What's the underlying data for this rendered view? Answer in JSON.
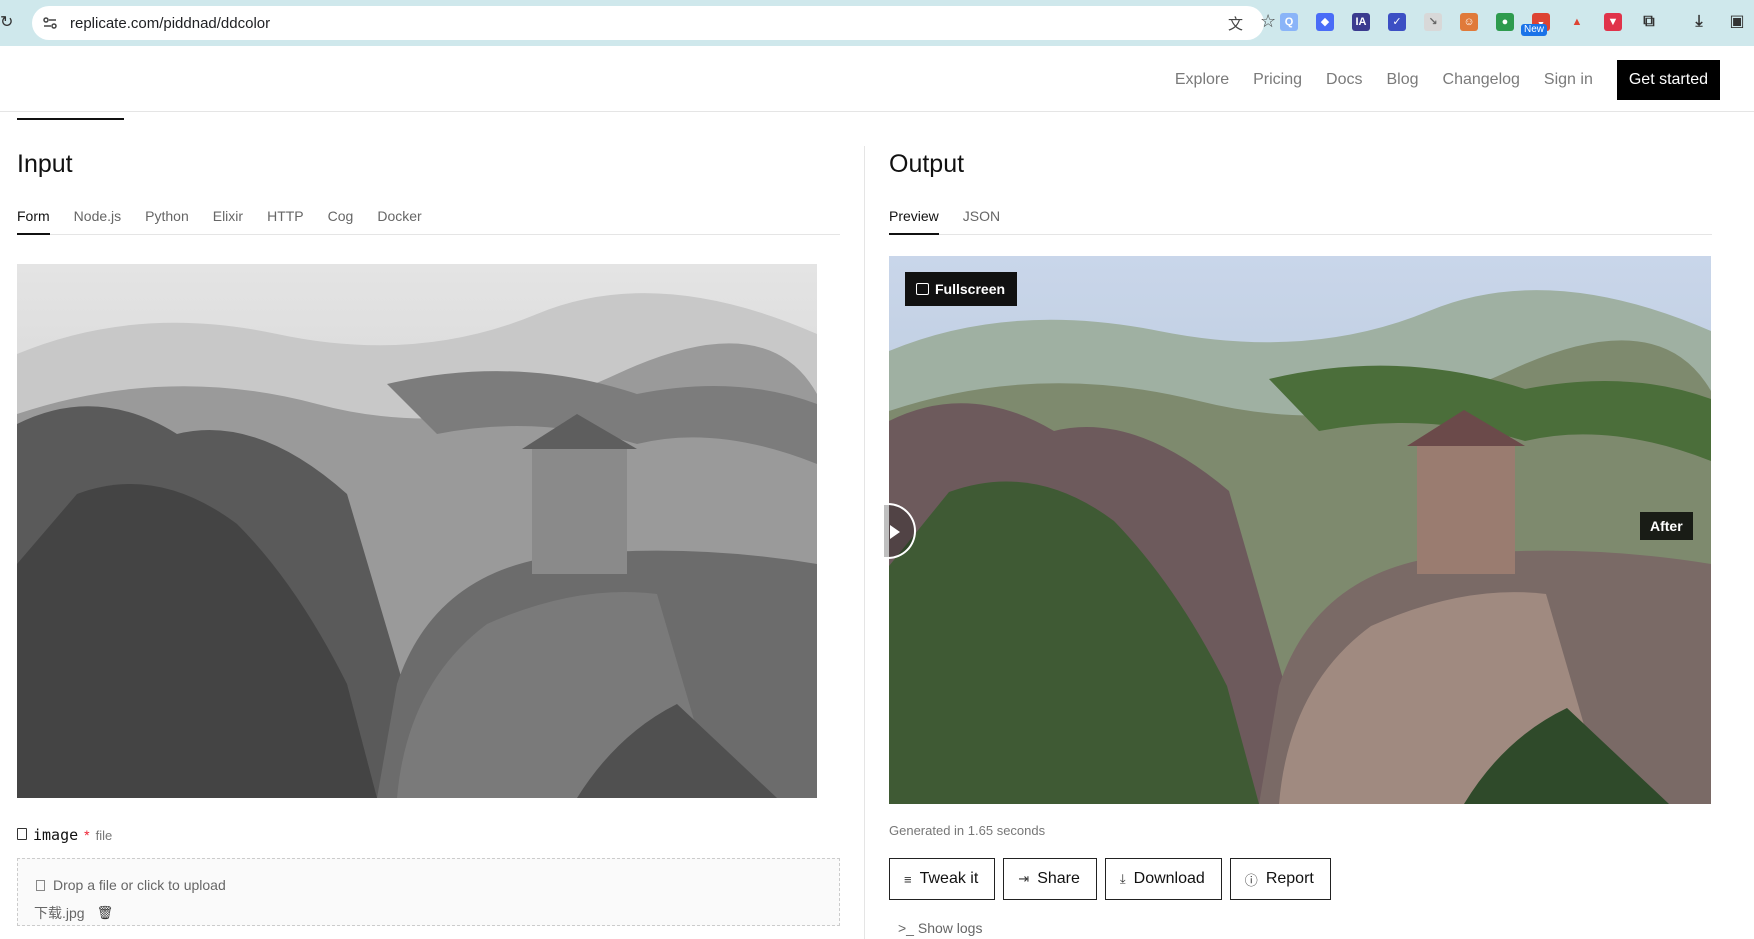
{
  "browser": {
    "url": "replicate.com/piddnad/ddcolor",
    "new_badge": "New",
    "extension_badge_count": "1"
  },
  "nav": {
    "items": [
      "Explore",
      "Pricing",
      "Docs",
      "Blog",
      "Changelog",
      "Sign in"
    ],
    "cta": "Get started"
  },
  "input": {
    "title": "Input",
    "tabs": [
      "Form",
      "Node.js",
      "Python",
      "Elixir",
      "HTTP",
      "Cog",
      "Docker"
    ],
    "field": {
      "name": "image",
      "required_mark": "*",
      "type": "file"
    },
    "dropzone_hint": "Drop a file or click to upload",
    "file_name": "下载.jpg"
  },
  "output": {
    "title": "Output",
    "tabs": [
      "Preview",
      "JSON"
    ],
    "fullscreen_label": "Fullscreen",
    "after_label": "After",
    "generated_text": "Generated in 1.65 seconds",
    "actions": [
      "Tweak it",
      "Share",
      "Download",
      "Report"
    ],
    "show_logs": "Show logs"
  },
  "colors": {
    "browser_bar": "#cfe8ec",
    "cta_bg": "#000000",
    "accent_text": "#111111"
  }
}
